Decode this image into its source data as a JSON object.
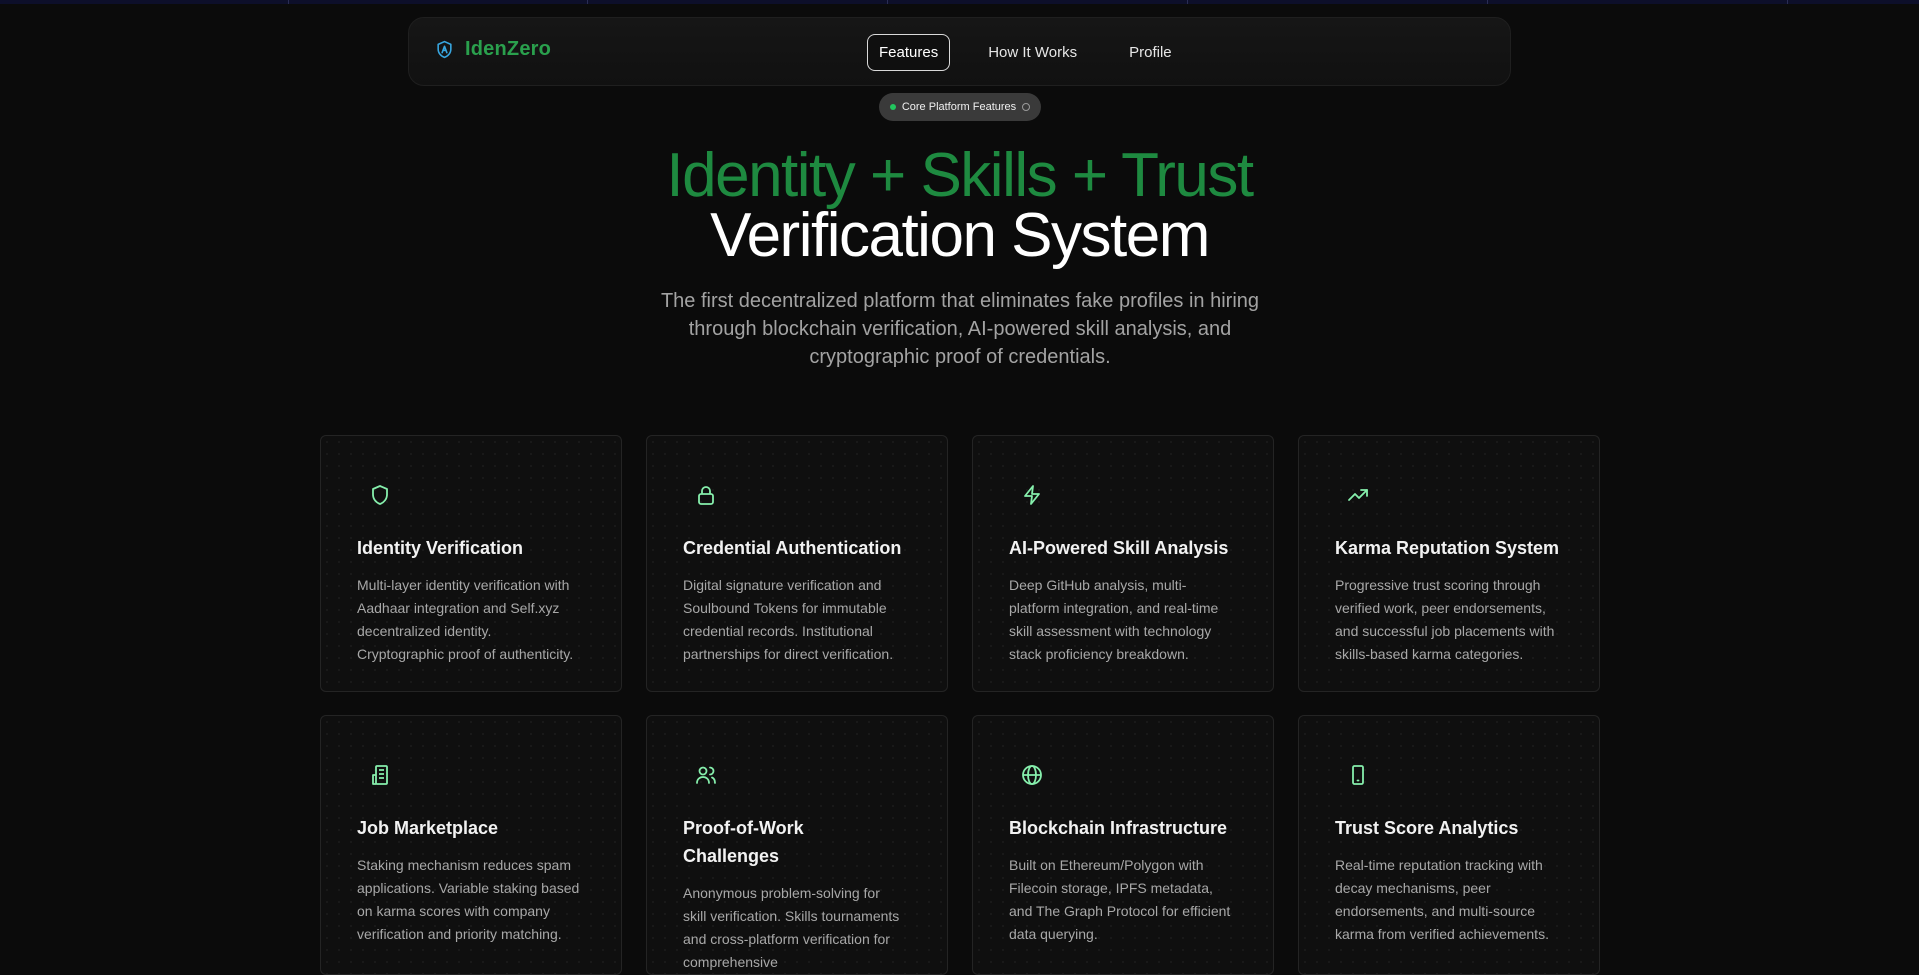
{
  "brand": {
    "name": "IdenZero",
    "logo_icon": "shield-icon",
    "accent": "#2aa04d"
  },
  "nav": {
    "links": [
      {
        "label": "Features",
        "active": true
      },
      {
        "label": "How It Works",
        "active": false
      },
      {
        "label": "Profile",
        "active": false
      }
    ]
  },
  "badge": {
    "label": "Core Platform Features"
  },
  "hero": {
    "title_line1": "Identity + Skills + Trust",
    "title_line2": "Verification System",
    "subtitle": "The first decentralized platform that eliminates fake profiles in hiring through blockchain verification, AI-powered skill analysis, and cryptographic proof of credentials."
  },
  "features": [
    {
      "icon": "shield-icon",
      "title": "Identity Verification",
      "description": "Multi-layer identity verification with Aadhaar integration and Self.xyz decentralized identity. Cryptographic proof of authenticity."
    },
    {
      "icon": "lock-icon",
      "title": "Credential Authentication",
      "description": "Digital signature verification and Soulbound Tokens for immutable credential records. Institutional partnerships for direct verification."
    },
    {
      "icon": "lightning-icon",
      "title": "AI-Powered Skill Analysis",
      "description": "Deep GitHub analysis, multi-platform integration, and real-time skill assessment with technology stack proficiency breakdown."
    },
    {
      "icon": "trending-up-icon",
      "title": "Karma Reputation System",
      "description": "Progressive trust scoring through verified work, peer endorsements, and successful job placements with skills-based karma categories."
    },
    {
      "icon": "building-icon",
      "title": "Job Marketplace",
      "description": "Staking mechanism reduces spam applications. Variable staking based on karma scores with company verification and priority matching."
    },
    {
      "icon": "users-icon",
      "title": "Proof-of-Work Challenges",
      "description": "Anonymous problem-solving for skill verification. Skills tournaments and cross-platform verification for comprehensive"
    },
    {
      "icon": "globe-icon",
      "title": "Blockchain Infrastructure",
      "description": "Built on Ethereum/Polygon with Filecoin storage, IPFS metadata, and The Graph Protocol for efficient data querying."
    },
    {
      "icon": "smartphone-icon",
      "title": "Trust Score Analytics",
      "description": "Real-time reputation tracking with decay mechanisms, peer endorsements, and multi-source karma from verified achievements."
    }
  ]
}
